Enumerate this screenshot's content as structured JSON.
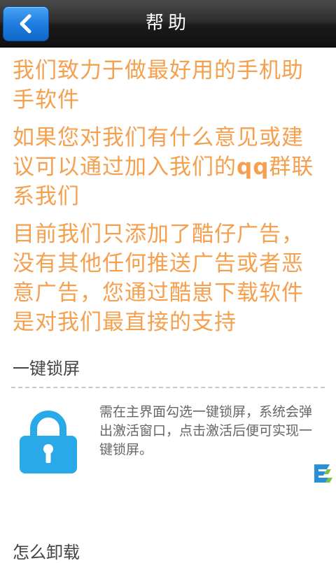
{
  "header": {
    "title": "帮助",
    "back_label": "返回"
  },
  "paragraphs": [
    "我们致力于做最好用的手机助手软件",
    "如果您对我们有什么意见或建议可以通过加入我们的qq群联系我们",
    "目前我们只添加了酷仔广告，没有其他任何推送广告或者恶意广告，您通过酷崽下载软件是对我们最直接的支持"
  ],
  "sections": {
    "lock": {
      "title": "一键锁屏",
      "description": "需在主界面勾选一键锁屏，系统会弹出激活窗口，点击激活后便可实现一键锁屏。"
    },
    "uninstall": {
      "title": "怎么卸载"
    }
  },
  "colors": {
    "accent_text": "#f5a04f",
    "back_button": "#1f7fe0",
    "lock_icon": "#29a9e8"
  },
  "icons": {
    "back": "chevron-left-icon",
    "lock": "lock-icon",
    "watermark": "watermark-logo-icon"
  }
}
